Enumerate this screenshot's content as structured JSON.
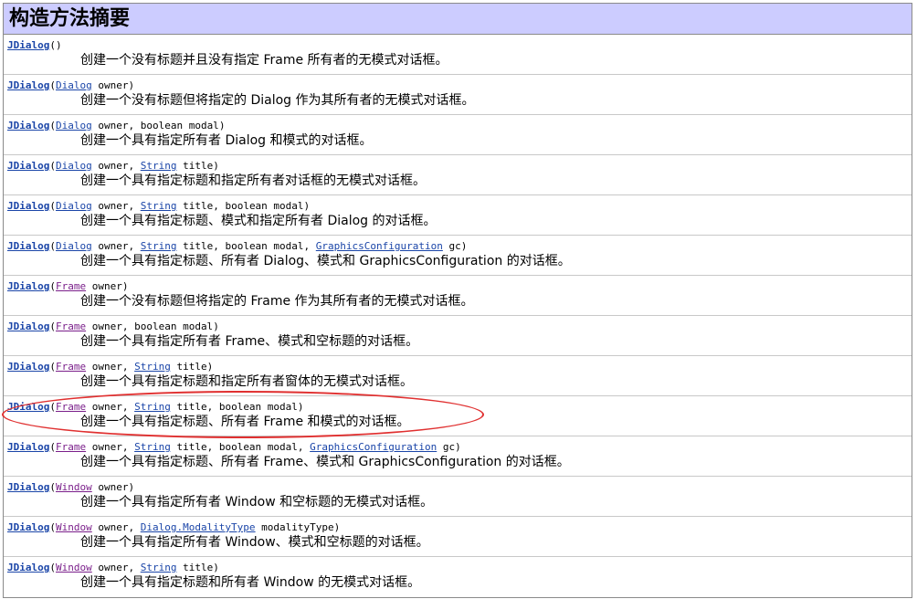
{
  "header": {
    "title": "构造方法摘要"
  },
  "rows": [
    {
      "name": "JDialog",
      "params": [],
      "suffix": "()",
      "desc": "创建一个没有标题并且没有指定 Frame 所有者的无模式对话框。"
    },
    {
      "name": "JDialog",
      "params": [
        {
          "type": "Dialog",
          "kind": "iface"
        },
        {
          "text": " owner"
        }
      ],
      "desc": "创建一个没有标题但将指定的 Dialog 作为其所有者的无模式对话框。"
    },
    {
      "name": "JDialog",
      "params": [
        {
          "type": "Dialog",
          "kind": "iface"
        },
        {
          "text": " owner, boolean modal"
        }
      ],
      "desc": "创建一个具有指定所有者 Dialog 和模式的对话框。"
    },
    {
      "name": "JDialog",
      "params": [
        {
          "type": "Dialog",
          "kind": "iface"
        },
        {
          "text": " owner, "
        },
        {
          "type": "String",
          "kind": "iface"
        },
        {
          "text": " title"
        }
      ],
      "desc": "创建一个具有指定标题和指定所有者对话框的无模式对话框。"
    },
    {
      "name": "JDialog",
      "params": [
        {
          "type": "Dialog",
          "kind": "iface"
        },
        {
          "text": " owner, "
        },
        {
          "type": "String",
          "kind": "iface"
        },
        {
          "text": " title, boolean modal"
        }
      ],
      "desc": "创建一个具有指定标题、模式和指定所有者 Dialog 的对话框。"
    },
    {
      "name": "JDialog",
      "params": [
        {
          "type": "Dialog",
          "kind": "iface"
        },
        {
          "text": " owner, "
        },
        {
          "type": "String",
          "kind": "iface"
        },
        {
          "text": " title, boolean modal, "
        },
        {
          "type": "GraphicsConfiguration",
          "kind": "iface"
        },
        {
          "text": " gc"
        }
      ],
      "desc": "创建一个具有指定标题、所有者 Dialog、模式和 GraphicsConfiguration 的对话框。"
    },
    {
      "name": "JDialog",
      "params": [
        {
          "type": "Frame",
          "kind": "cls"
        },
        {
          "text": " owner"
        }
      ],
      "desc": "创建一个没有标题但将指定的 Frame 作为其所有者的无模式对话框。"
    },
    {
      "name": "JDialog",
      "params": [
        {
          "type": "Frame",
          "kind": "cls"
        },
        {
          "text": " owner, boolean modal"
        }
      ],
      "desc": "创建一个具有指定所有者 Frame、模式和空标题的对话框。"
    },
    {
      "name": "JDialog",
      "params": [
        {
          "type": "Frame",
          "kind": "cls"
        },
        {
          "text": " owner, "
        },
        {
          "type": "String",
          "kind": "iface"
        },
        {
          "text": " title"
        }
      ],
      "desc": "创建一个具有指定标题和指定所有者窗体的无模式对话框。"
    },
    {
      "name": "JDialog",
      "params": [
        {
          "type": "Frame",
          "kind": "cls"
        },
        {
          "text": " owner, "
        },
        {
          "type": "String",
          "kind": "iface"
        },
        {
          "text": " title, boolean modal"
        }
      ],
      "desc": "创建一个具有指定标题、所有者 Frame 和模式的对话框。"
    },
    {
      "name": "JDialog",
      "params": [
        {
          "type": "Frame",
          "kind": "cls"
        },
        {
          "text": " owner, "
        },
        {
          "type": "String",
          "kind": "iface"
        },
        {
          "text": " title, boolean modal, "
        },
        {
          "type": "GraphicsConfiguration",
          "kind": "iface"
        },
        {
          "text": " gc"
        }
      ],
      "desc": "创建一个具有指定标题、所有者 Frame、模式和 GraphicsConfiguration 的对话框。"
    },
    {
      "name": "JDialog",
      "params": [
        {
          "type": "Window",
          "kind": "cls"
        },
        {
          "text": " owner"
        }
      ],
      "desc": "创建一个具有指定所有者 Window 和空标题的无模式对话框。"
    },
    {
      "name": "JDialog",
      "params": [
        {
          "type": "Window",
          "kind": "cls"
        },
        {
          "text": " owner, "
        },
        {
          "type": "Dialog.ModalityType",
          "kind": "iface"
        },
        {
          "text": " modalityType"
        }
      ],
      "desc": "创建一个具有指定所有者 Window、模式和空标题的对话框。"
    },
    {
      "name": "JDialog",
      "params": [
        {
          "type": "Window",
          "kind": "cls"
        },
        {
          "text": " owner, "
        },
        {
          "type": "String",
          "kind": "iface"
        },
        {
          "text": " title"
        }
      ],
      "desc": "创建一个具有指定标题和所有者 Window 的无模式对话框。"
    }
  ],
  "highlight": {
    "row_index": 9,
    "color": "#e03030"
  }
}
